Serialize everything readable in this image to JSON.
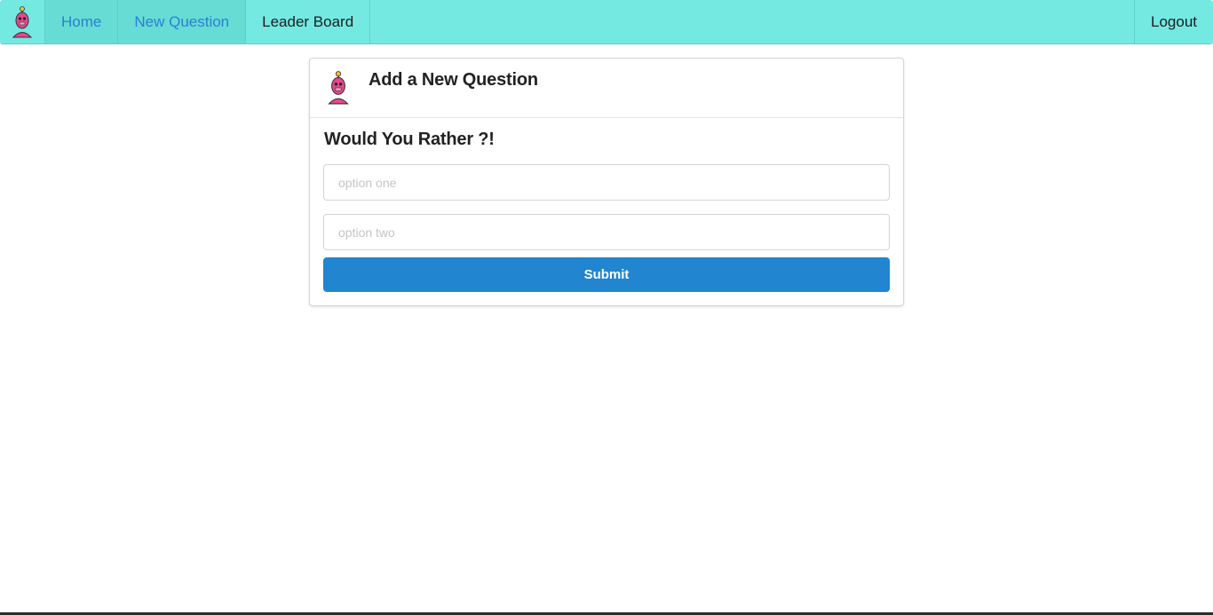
{
  "nav": {
    "logo_icon": "robot-avatar-icon",
    "items": [
      {
        "label": "Home",
        "active": true
      },
      {
        "label": "New Question",
        "active": true
      },
      {
        "label": "Leader Board",
        "active": false
      }
    ],
    "logout_label": "Logout"
  },
  "card": {
    "avatar_icon": "robot-avatar-icon",
    "title": "Add a New Question",
    "prompt": "Would You Rather ?!",
    "option_one": {
      "value": "",
      "placeholder": "option one"
    },
    "option_two": {
      "value": "",
      "placeholder": "option two"
    },
    "submit_label": "Submit"
  },
  "colors": {
    "navbar": "#74e9e2",
    "active_link": "#2a7fd4",
    "submit": "#2185d0",
    "avatar": "#e8478f"
  }
}
